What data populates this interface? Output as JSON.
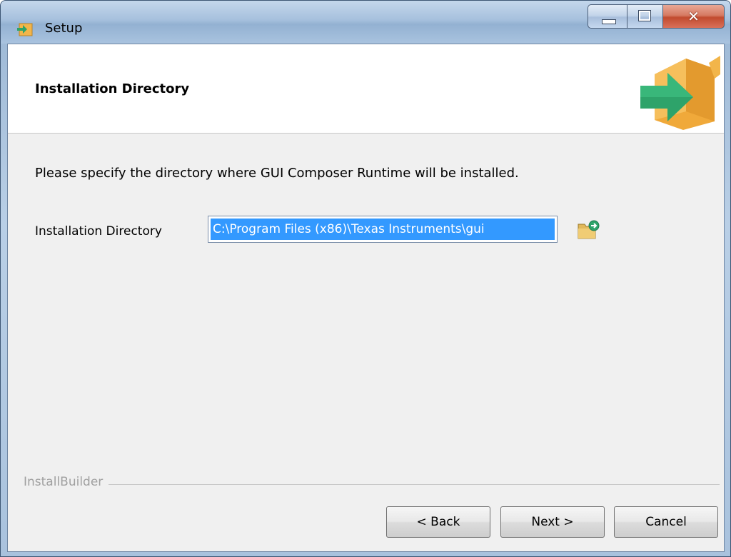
{
  "window": {
    "title": "Setup",
    "caption_buttons": {
      "minimize": "minimize",
      "maximize": "maximize",
      "close": "close"
    }
  },
  "header": {
    "title": "Installation Directory",
    "logo_icon": "installer-box-arrow-icon"
  },
  "main": {
    "instruction": "Please specify the directory where GUI Composer Runtime will be installed.",
    "directory_label": "Installation Directory",
    "directory_value": "C:\\Program Files (x86)\\Texas Instruments\\gui",
    "browse_icon": "folder-browse-icon"
  },
  "footer": {
    "builder_label": "InstallBuilder",
    "back_label": "< Back",
    "next_label": "Next >",
    "cancel_label": "Cancel"
  },
  "colors": {
    "selection": "#3399ff",
    "close_button": "#c24b2f",
    "logo_box": "#f2b54a",
    "logo_arrow": "#2ea36a"
  }
}
